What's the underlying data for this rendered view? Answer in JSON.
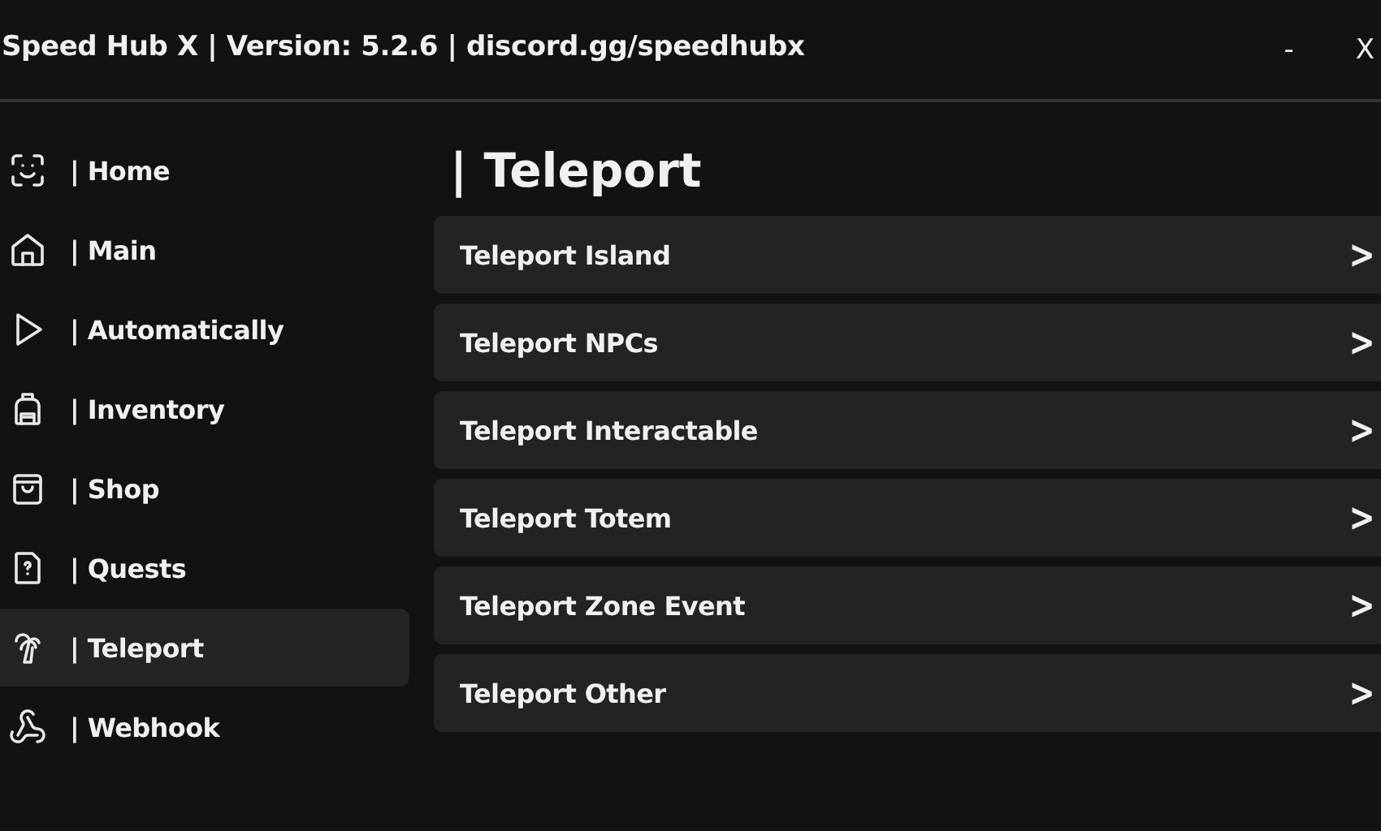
{
  "window": {
    "title": "Speed Hub X | Version: 5.2.6 | discord.gg/speedhubx",
    "minimize": "-",
    "close": "X"
  },
  "sidebar": {
    "items": [
      {
        "label": "| Home",
        "selected": false
      },
      {
        "label": "| Main",
        "selected": false
      },
      {
        "label": "| Automatically",
        "selected": false
      },
      {
        "label": "| Inventory",
        "selected": false
      },
      {
        "label": "| Shop",
        "selected": false
      },
      {
        "label": "| Quests",
        "selected": false
      },
      {
        "label": "| Teleport",
        "selected": true
      },
      {
        "label": "| Webhook",
        "selected": false
      }
    ]
  },
  "content": {
    "title": "| Teleport",
    "rows": [
      {
        "label": "Teleport Island",
        "chevron": ">"
      },
      {
        "label": "Teleport NPCs",
        "chevron": ">"
      },
      {
        "label": "Teleport Interactable",
        "chevron": ">"
      },
      {
        "label": "Teleport Totem",
        "chevron": ">"
      },
      {
        "label": "Teleport Zone Event",
        "chevron": ">"
      },
      {
        "label": "Teleport Other",
        "chevron": ">"
      }
    ]
  }
}
